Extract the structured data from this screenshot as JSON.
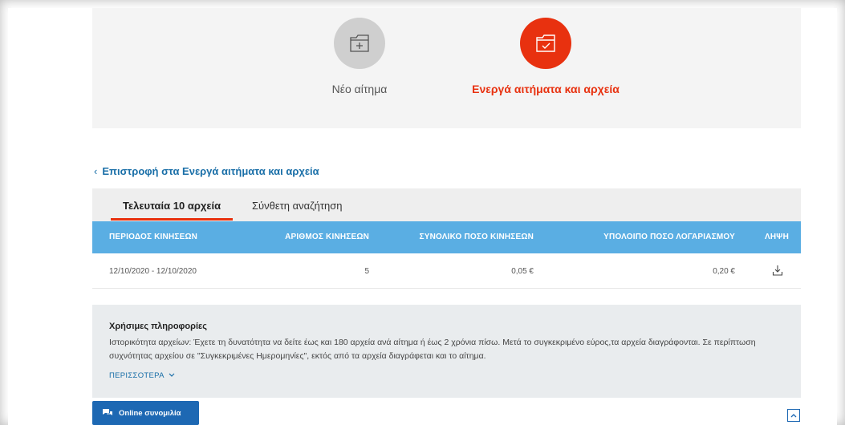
{
  "actions": {
    "new_request": {
      "label": "Νέο αίτημα"
    },
    "active_requests": {
      "label": "Ενεργά αιτήματα και αρχεία"
    }
  },
  "back_link": {
    "label": "Επιστροφή στα Ενεργά αιτήματα και αρχεία"
  },
  "tabs": [
    {
      "label": "Τελευταία 10 αρχεία"
    },
    {
      "label": "Σύνθετη αναζήτηση"
    }
  ],
  "table": {
    "headers": [
      "ΠΕΡΙΟΔΟΣ ΚΙΝΗΣΕΩΝ",
      "ΑΡΙΘΜΟΣ ΚΙΝΗΣΕΩΝ",
      "ΣΥΝΟΛΙΚΟ ΠΟΣΟ ΚΙΝΗΣΕΩΝ",
      "ΥΠΟΛΟΙΠΟ ΠΟΣΟ ΛΟΓΑΡΙΑΣΜΟΥ",
      "ΛΗΨΗ"
    ],
    "rows": [
      {
        "period": "12/10/2020 - 12/10/2020",
        "count": "5",
        "total": "0,05 €",
        "balance": "0,20 €"
      }
    ]
  },
  "info": {
    "title": "Χρήσιμες πληροφορίες",
    "text": "Ιστορικότητα αρχείων: Έχετε τη δυνατότητα να δείτε έως και 180 αρχεία ανά αίτημα ή έως 2 χρόνια πίσω. Μετά το συγκεκριμένο εύρος,τα αρχεία διαγράφονται. Σε περίπτωση συχνότητας αρχείου σε \"Συγκεκριμένες Ημερομηνίες\", εκτός από τα αρχεία διαγράφεται και το αίτημα.",
    "more_label": "ΠΕΡΙΣΣΟΤΕΡΑ"
  },
  "chat": {
    "label": "Online συνομιλία"
  },
  "colors": {
    "accent": "#e8310f",
    "table_header": "#5aaee3",
    "link": "#1a6fa8",
    "chat_button": "#1d68b3"
  },
  "icons": [
    "folder-plus-icon",
    "folder-check-icon",
    "chevron-left-icon",
    "download-icon",
    "chevron-down-icon",
    "chat-icon",
    "chevron-up-icon"
  ]
}
